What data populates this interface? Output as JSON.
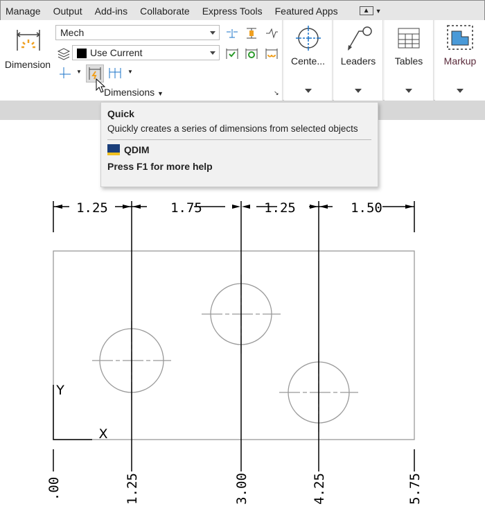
{
  "ribbon_tabs": [
    "Manage",
    "Output",
    "Add-ins",
    "Collaborate",
    "Express Tools",
    "Featured Apps"
  ],
  "dimension_button": "Dimension",
  "dim_style": "Mech",
  "layer": "Use Current",
  "panel_title": "Dimensions",
  "panels": [
    "Cente...",
    "Leaders",
    "Tables",
    "Markup"
  ],
  "tooltip": {
    "title": "Quick",
    "description": "Quickly creates a series of dimensions from selected objects",
    "command": "QDIM",
    "help": "Press F1 for more help"
  },
  "drawing": {
    "dimensions": [
      "1.25",
      "1.75",
      "1.25",
      "1.50"
    ],
    "ordinates": [
      ".00",
      "1.25",
      "3.00",
      "4.25",
      "5.75"
    ],
    "ucs_x": "X",
    "ucs_y": "Y"
  },
  "colors": {
    "accent": "#1a73c8",
    "highlight": "#f0a020"
  }
}
